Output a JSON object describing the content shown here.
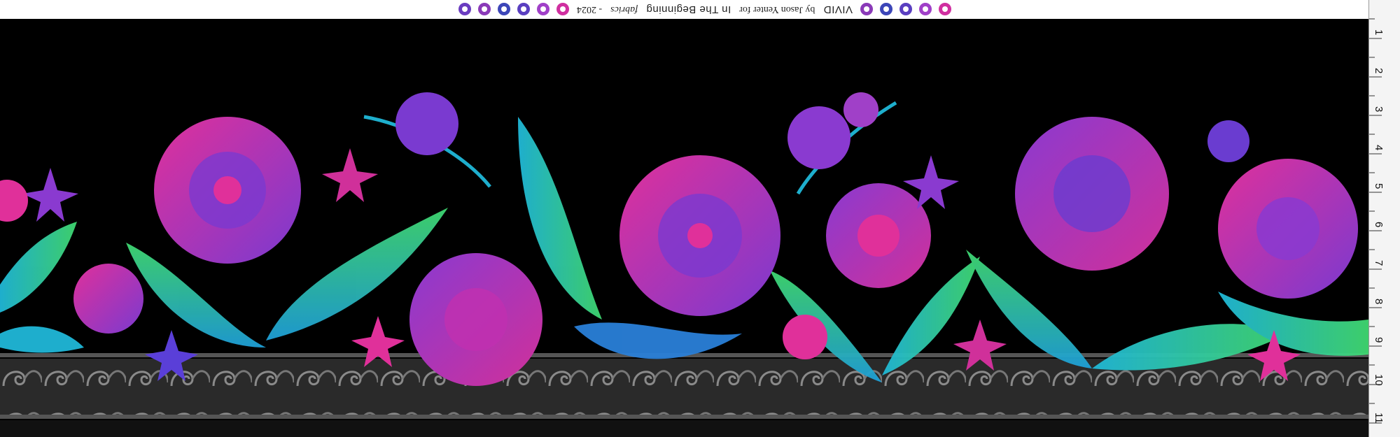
{
  "selvage": {
    "collection": "VIVID",
    "by_line": "by Jason Yenter for",
    "company": "In The Beginning",
    "script": "fabrics",
    "year": "- 2024",
    "chip_colors": [
      "#8a3ab8",
      "#3c46b8",
      "#5a3fc0",
      "#a040c8",
      "#d02fa0",
      "#6a3cc0"
    ]
  },
  "ruler": {
    "marks": [
      "1",
      "2",
      "3",
      "4",
      "5",
      "6",
      "7",
      "8",
      "9",
      "10",
      "11"
    ]
  },
  "panel": {
    "background": "#000000",
    "border_stripe": "#3a3a3a",
    "palette": {
      "magenta": "#e0309a",
      "purple": "#8a3ad0",
      "violet": "#5a3fd8",
      "cyan": "#20b8d8",
      "green": "#40d870",
      "teal": "#1fa0c0"
    }
  }
}
